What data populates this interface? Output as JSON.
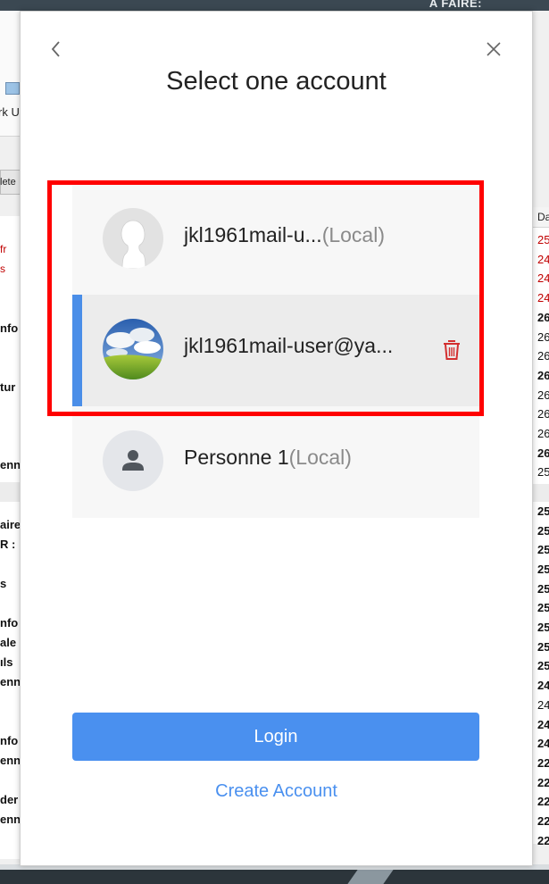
{
  "background_window_top": {
    "banner_text": "A FAIRE:"
  },
  "background_window_left": {
    "toolbar_text": "rk U",
    "button_text": "lete",
    "list_items": [
      {
        "text": "fr",
        "style": "red"
      },
      {
        "text": "s",
        "style": "red"
      },
      {
        "text": "nfo",
        "style": "bold"
      },
      {
        "text": "tur",
        "style": "bold"
      },
      {
        "text": "enn",
        "style": "bold"
      },
      {
        "text": "aire",
        "style": "bold"
      },
      {
        "text": "R :",
        "style": "bold"
      },
      {
        "text": "s",
        "style": "bold"
      },
      {
        "text": "nfo",
        "style": "bold"
      },
      {
        "text": "ale",
        "style": "bold"
      },
      {
        "text": "ıls",
        "style": "bold"
      },
      {
        "text": "enn",
        "style": "bold"
      },
      {
        "text": "nfo",
        "style": "bold"
      },
      {
        "text": "enn",
        "style": "bold"
      },
      {
        "text": "der",
        "style": "bold"
      },
      {
        "text": "enn",
        "style": "bold"
      }
    ]
  },
  "background_window_right": {
    "column_header": "Da",
    "list_items": [
      {
        "text": "25",
        "style": "red"
      },
      {
        "text": "24",
        "style": "red"
      },
      {
        "text": "24",
        "style": "red"
      },
      {
        "text": "24",
        "style": "red"
      },
      {
        "text": "26",
        "style": "bold"
      },
      {
        "text": "26",
        "style": "norm"
      },
      {
        "text": "26",
        "style": "norm"
      },
      {
        "text": "26",
        "style": "bold"
      },
      {
        "text": "26",
        "style": "norm"
      },
      {
        "text": "26",
        "style": "norm"
      },
      {
        "text": "26",
        "style": "norm"
      },
      {
        "text": "26",
        "style": "bold"
      },
      {
        "text": "25",
        "style": "norm"
      },
      {
        "text": "25",
        "style": "bold"
      },
      {
        "text": "25",
        "style": "bold"
      },
      {
        "text": "25",
        "style": "bold"
      },
      {
        "text": "25",
        "style": "bold"
      },
      {
        "text": "25",
        "style": "bold"
      },
      {
        "text": "25",
        "style": "bold"
      },
      {
        "text": "25",
        "style": "bold"
      },
      {
        "text": "25",
        "style": "bold"
      },
      {
        "text": "25",
        "style": "bold"
      },
      {
        "text": "25",
        "style": "bold"
      },
      {
        "text": "24",
        "style": "bold"
      },
      {
        "text": "24",
        "style": "norm"
      },
      {
        "text": "24",
        "style": "bold"
      },
      {
        "text": "24",
        "style": "bold"
      },
      {
        "text": "22",
        "style": "bold"
      },
      {
        "text": "22",
        "style": "bold"
      },
      {
        "text": "22",
        "style": "bold"
      },
      {
        "text": "22",
        "style": "bold"
      },
      {
        "text": "22",
        "style": "bold"
      }
    ]
  },
  "dialog": {
    "title": "Select one account",
    "back_icon": "chevron-left-icon",
    "close_icon": "close-icon",
    "accounts": [
      {
        "name": "jkl1961mail-u...",
        "tag": "(Local)",
        "avatar": "mannequin-head",
        "selected": false,
        "deletable": false
      },
      {
        "name": "jkl1961mail-user@ya...",
        "tag": "",
        "avatar": "sky-meadow-photo",
        "selected": true,
        "deletable": true
      },
      {
        "name": "Personne 1",
        "tag": "(Local)",
        "avatar": "person-silhouette",
        "selected": false,
        "deletable": false
      }
    ],
    "delete_icon": "trash-icon",
    "login_label": "Login",
    "create_account_label": "Create Account"
  },
  "colors": {
    "accent": "#4a90ef",
    "selection_bar": "#4a8ee8",
    "highlight_box": "#ff0000",
    "delete_icon": "#d32f2f"
  }
}
